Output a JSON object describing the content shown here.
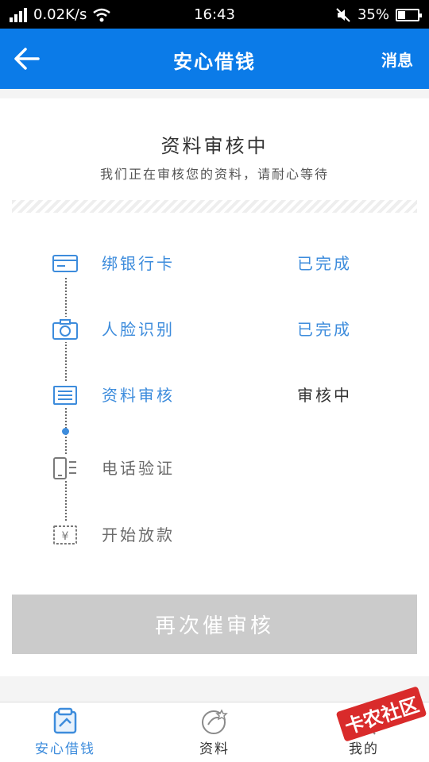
{
  "status_bar": {
    "network_speed": "0.02K/s",
    "time": "16:43",
    "battery": "35%"
  },
  "header": {
    "title": "安心借钱",
    "messages_label": "消息"
  },
  "review": {
    "title": "资料审核中",
    "subtitle": "我们正在审核您的资料，请耐心等待"
  },
  "steps": [
    {
      "label": "绑银行卡",
      "state": "已完成",
      "icon": "bank-card-icon"
    },
    {
      "label": "人脸识别",
      "state": "已完成",
      "icon": "camera-icon"
    },
    {
      "label": "资料审核",
      "state": "审核中",
      "icon": "document-icon"
    },
    {
      "label": "电话验证",
      "state": "",
      "icon": "phone-icon"
    },
    {
      "label": "开始放款",
      "state": "",
      "icon": "money-icon"
    }
  ],
  "action_button": "再次催审核",
  "bottom_nav": [
    {
      "label": "安心借钱",
      "icon": "loan-icon",
      "active": true
    },
    {
      "label": "资料",
      "icon": "profile-data-icon",
      "active": false
    },
    {
      "label": "我的",
      "icon": "user-icon",
      "active": false
    }
  ],
  "watermark": "卡农社区",
  "colors": {
    "primary": "#0b7be8",
    "accent": "#3d8cdc",
    "button_disabled": "#cbcbcb"
  }
}
